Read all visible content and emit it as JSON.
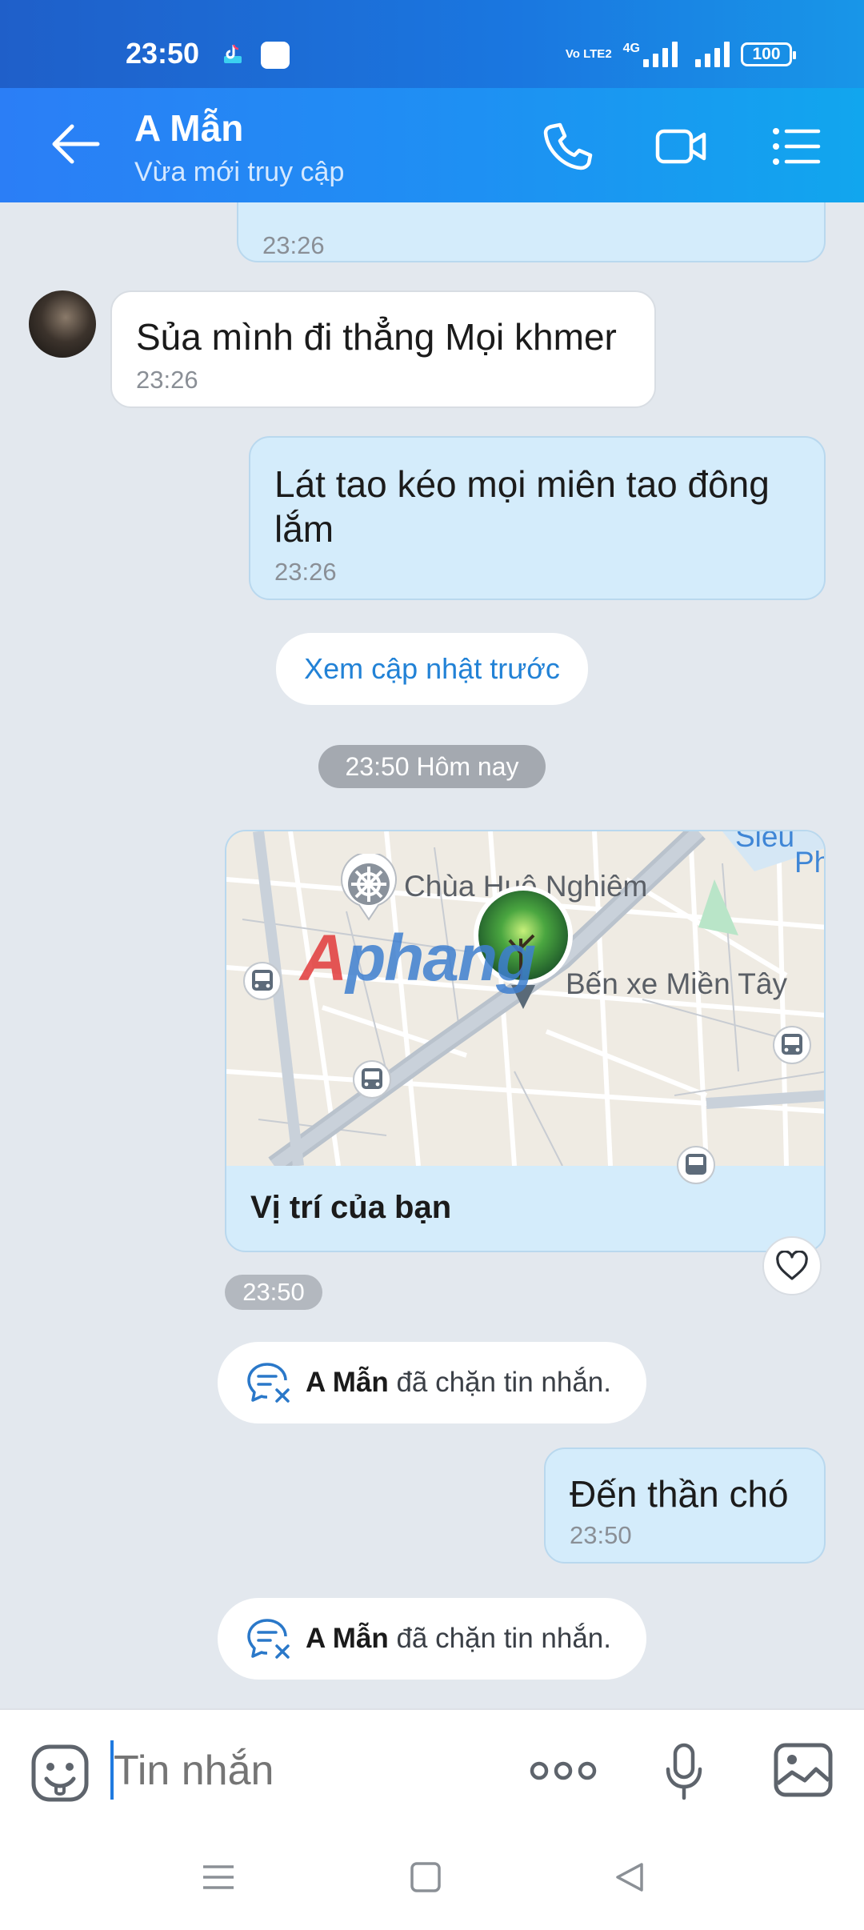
{
  "status_bar": {
    "time": "23:50",
    "volte": "Vo LTE2",
    "network": "4G",
    "battery": "100"
  },
  "header": {
    "contact_name": "A Mẫn",
    "contact_status": "Vừa mới truy cập"
  },
  "messages": [
    {
      "direction": "out",
      "text": "",
      "time": "23:26"
    },
    {
      "direction": "in",
      "text": "Sủa mình đi thẳng Mọi khmer",
      "time": "23:26"
    },
    {
      "direction": "out",
      "text": "Lát tao kéo mọi miên tao đông lắm",
      "time": "23:26"
    }
  ],
  "view_earlier": "Xem cập nhật trước",
  "date_separator": "23:50 Hôm nay",
  "location_card": {
    "labels": {
      "temple": "Chùa Huệ Nghiêm",
      "bus_station": "Bến xe Miền Tây",
      "corner_top": "Siêu",
      "corner_right": "Ph"
    },
    "watermark": "Aphang",
    "caption": "Vị trí của bạn",
    "time": "23:50"
  },
  "blocked_notice": {
    "name": "A Mẫn",
    "text": "đã chặn tin nhắn."
  },
  "last_message": {
    "text": "Đến thần chó",
    "time": "23:50"
  },
  "input": {
    "placeholder": "Tin nhắn"
  },
  "colors": {
    "header_start": "#2b7ef6",
    "header_end": "#11a6ee",
    "bubble_out": "#d4ecfb",
    "link": "#2282d6"
  }
}
